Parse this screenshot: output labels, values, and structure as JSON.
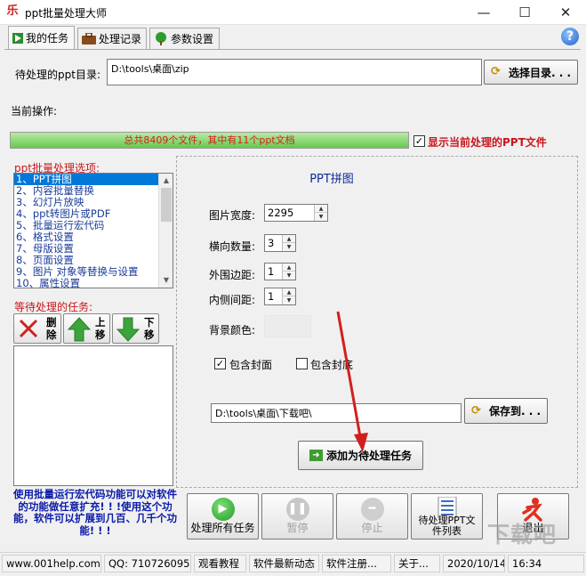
{
  "window": {
    "title": "ppt批量处理大师",
    "app_icon_glyph": "乐",
    "minimize": "—",
    "maximize": "☐",
    "close": "✕"
  },
  "tabs": [
    {
      "label": "我的任务",
      "icon": "play-icon",
      "active": true
    },
    {
      "label": "处理记录",
      "icon": "briefcase-icon",
      "active": false
    },
    {
      "label": "参数设置",
      "icon": "tree-icon",
      "active": false
    }
  ],
  "help_glyph": "?",
  "dir": {
    "label": "待处理的ppt目录:",
    "value": "D:\\tools\\桌面\\zip",
    "button": "选择目录. . ."
  },
  "current_op_label": "当前操作:",
  "progress": {
    "text": "总共8409个文件，其中有11个ppt文档",
    "fraction": 1.0
  },
  "show_current": {
    "label": "显示当前处理的PPT文件",
    "checked": true
  },
  "options": {
    "label": "ppt批量处理选项:",
    "items": [
      "1、PPT拼图",
      "2、内容批量替换",
      "3、幻灯片放映",
      "4、ppt转图片或PDF",
      "5、批量运行宏代码",
      "6、格式设置",
      "7、母版设置",
      "8、页面设置",
      "9、图片 对象等替换与设置",
      "10、属性设置"
    ],
    "selected_index": 0
  },
  "pending": {
    "label": "等待处理的任务:",
    "delete_button": "删除",
    "up_button": "上移",
    "down_button": "下移"
  },
  "note": "使用批量运行宏代码功能可以对软件的功能做任意扩充! ! !使用这个功能，软件可以扩展到几百、几千个功能! ! !",
  "panel": {
    "title": "PPT拼图",
    "image_width_label": "图片宽度:",
    "image_width_value": "2295",
    "horizontal_count_label": "横向数量:",
    "horizontal_count_value": "3",
    "outer_margin_label": "外围边距:",
    "outer_margin_value": "1",
    "inner_spacing_label": "内侧间距:",
    "inner_spacing_value": "1",
    "bg_color_label": "背景颜色:",
    "bg_color": "#ececec",
    "include_cover_label": "包含封面",
    "include_cover_checked": true,
    "include_back_label": "包含封底",
    "include_back_checked": false,
    "save_path": "D:\\tools\\桌面\\下载吧\\",
    "save_button": "保存到. . .",
    "add_task_button": "添加为待处理任务"
  },
  "bottom_buttons": {
    "process_all": "处理所有任务",
    "pause": "暂停",
    "stop": "停止",
    "pending_list": "待处理PPT文件列表",
    "exit": "退出"
  },
  "status": {
    "website": "www.001help.com",
    "qq": "QQ:  710726095",
    "tutorial": "观看教程",
    "news": "软件最新动态",
    "register": "软件注册...",
    "about": "关于...",
    "date": "2020/10/14",
    "time": "16:34"
  },
  "watermark": "下载吧",
  "colors": {
    "accent_red": "#c8161d",
    "link_blue": "#1a3c99",
    "progress_green": "#66c94e",
    "selection_blue": "#0078d7"
  }
}
